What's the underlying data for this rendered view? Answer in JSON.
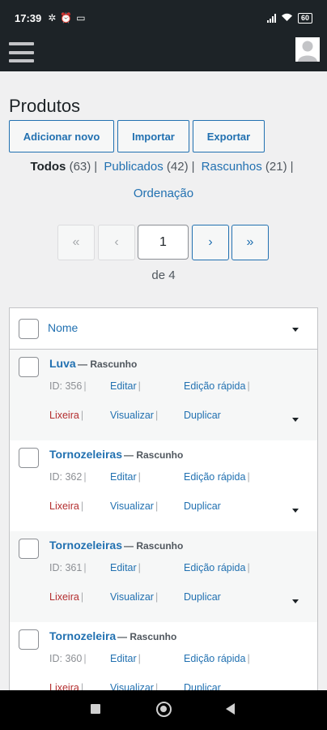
{
  "status_bar": {
    "time": "17:39",
    "left_icons": [
      "fan-icon",
      "alarm-icon",
      "laptop-icon"
    ],
    "battery": "60"
  },
  "admin_bar": {
    "menu_icon": "hamburger-menu-icon",
    "avatar_icon": "user-avatar-icon"
  },
  "page": {
    "title": "Produtos"
  },
  "actions": {
    "add_new": "Adicionar novo",
    "import": "Importar",
    "export": "Exportar"
  },
  "filters": {
    "all": {
      "label": "Todos",
      "count": "(63)"
    },
    "published": {
      "label": "Publicados",
      "count": "(42)"
    },
    "drafts": {
      "label": "Rascunhos",
      "count": "(21)"
    },
    "separator": "|",
    "ordering": "Ordenação"
  },
  "pagination": {
    "first": "«",
    "prev": "‹",
    "current": "1",
    "next": "›",
    "last": "»",
    "total_label": "de 4"
  },
  "table": {
    "header": {
      "name": "Nome"
    },
    "rows": [
      {
        "name": "Luva",
        "state": "— Rascunho",
        "id": "ID: 356",
        "edit": "Editar",
        "quick_edit": "Edição rápida",
        "trash": "Lixeira",
        "view": "Visualizar",
        "duplicate": "Duplicar"
      },
      {
        "name": "Tornozeleiras",
        "state": "— Rascunho",
        "id": "ID: 362",
        "edit": "Editar",
        "quick_edit": "Edição rápida",
        "trash": "Lixeira",
        "view": "Visualizar",
        "duplicate": "Duplicar"
      },
      {
        "name": "Tornozeleiras",
        "state": "— Rascunho",
        "id": "ID: 361",
        "edit": "Editar",
        "quick_edit": "Edição rápida",
        "trash": "Lixeira",
        "view": "Visualizar",
        "duplicate": "Duplicar"
      },
      {
        "name": "Tornozeleira",
        "state": "— Rascunho",
        "id": "ID: 360",
        "edit": "Editar",
        "quick_edit": "Edição rápida",
        "trash": "Lixeira",
        "view": "Visualizar",
        "duplicate": "Duplicar"
      }
    ],
    "row_separator": "|"
  },
  "colors": {
    "accent": "#2271b1",
    "admin_bar": "#1d2327",
    "trash": "#b32d2e"
  }
}
